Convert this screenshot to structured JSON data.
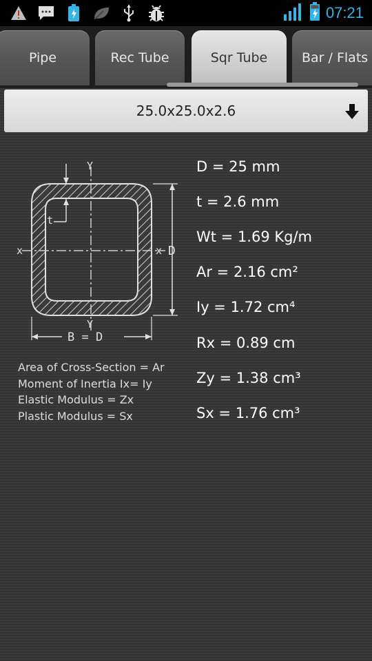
{
  "status_bar": {
    "time": "07:21",
    "icons": [
      "warning-icon",
      "message-icon",
      "battery-app-icon",
      "leaf-icon",
      "usb-icon",
      "debug-icon",
      "signal-icon",
      "battery-icon"
    ]
  },
  "tabs": [
    {
      "label": "Pipe",
      "active": false
    },
    {
      "label": "Rec Tube",
      "active": false
    },
    {
      "label": "Sqr Tube",
      "active": true
    },
    {
      "label": "Bar / Flats",
      "active": false
    }
  ],
  "selector": {
    "value": "25.0x25.0x2.6",
    "icon": "arrow-down-icon"
  },
  "diagram": {
    "axis_y_top": "Y",
    "axis_y_bottom": "Y",
    "axis_x_left": "x",
    "axis_x_right": "x",
    "label_t": "t",
    "label_d": "D",
    "label_bottom": "B = D"
  },
  "legend": [
    "Area of Cross-Section = Ar",
    "Moment of Inertia Ix= Iy",
    "Elastic Modulus = Zx",
    "Plastic Modulus = Sx"
  ],
  "results": [
    "D = 25 mm",
    "t = 2.6 mm",
    "Wt = 1.69 Kg/m",
    "Ar = 2.16 cm²",
    "Iy = 1.72 cm⁴",
    "Rx = 0.89 cm",
    "Zy = 1.38 cm³",
    "Sx = 1.76 cm³"
  ],
  "colors": {
    "accent": "#33b5e5",
    "background": "#383838"
  }
}
